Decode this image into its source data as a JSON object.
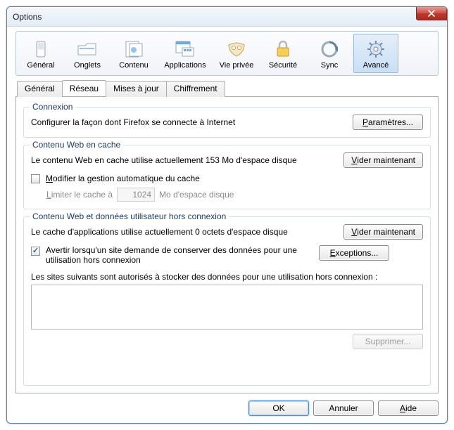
{
  "window": {
    "title": "Options"
  },
  "categories": [
    {
      "id": "general",
      "label": "Général"
    },
    {
      "id": "tabs",
      "label": "Onglets"
    },
    {
      "id": "content",
      "label": "Contenu"
    },
    {
      "id": "apps",
      "label": "Applications"
    },
    {
      "id": "privacy",
      "label": "Vie privée"
    },
    {
      "id": "security",
      "label": "Sécurité"
    },
    {
      "id": "sync",
      "label": "Sync"
    },
    {
      "id": "advanced",
      "label": "Avancé",
      "selected": true
    }
  ],
  "tabs": [
    {
      "id": "adv-general",
      "label": "Général"
    },
    {
      "id": "adv-network",
      "label": "Réseau",
      "active": true
    },
    {
      "id": "adv-updates",
      "label": "Mises à jour"
    },
    {
      "id": "adv-crypto",
      "label": "Chiffrement"
    }
  ],
  "connection": {
    "legend": "Connexion",
    "desc": "Configurer la façon dont Firefox se connecte à Internet",
    "settings_btn": "Paramètres..."
  },
  "cache": {
    "legend": "Contenu Web en cache",
    "usage": "Le contenu Web en cache utilise actuellement 153 Mo d'espace disque",
    "clear_btn": "Vider maintenant",
    "override_label": "Modifier la gestion automatique du cache",
    "override_checked": false,
    "limit_prefix": "Limiter le cache à",
    "limit_value": "1024",
    "limit_suffix": "Mo d'espace disque"
  },
  "offline": {
    "legend": "Contenu Web et données utilisateur hors connexion",
    "usage": "Le cache d'applications utilise actuellement 0 octets d'espace disque",
    "clear_btn": "Vider maintenant",
    "notify_checked": true,
    "notify_label": "Avertir lorsqu'un site demande de conserver des données pour une utilisation hors connexion",
    "exceptions_btn": "Exceptions...",
    "sites_label": "Les sites suivants sont autorisés à stocker des données pour une utilisation hors connexion :",
    "remove_btn": "Supprimer..."
  },
  "buttons": {
    "ok": "OK",
    "cancel": "Annuler",
    "help": "Aide"
  }
}
